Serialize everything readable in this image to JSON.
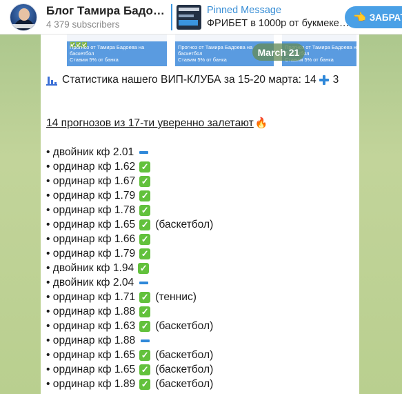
{
  "header": {
    "channel_title": "Блог Тамира Бадо…",
    "subscribers": "4 379 subscribers",
    "pinned_title": "Pinned Message",
    "pinned_text": "ФРИБЕТ в 1000р от букмеке…",
    "subscribe_label": "ЗАБРАТ"
  },
  "photos": [
    {
      "line1": "Прогноз от Тамира Бадоева на",
      "line2": "баскетбол",
      "line3": "Ставим 5% от банка"
    },
    {
      "line1": "Прогноз от Тамира Бадоева на",
      "line2": "баскетбол",
      "line3": "Ставим 5% от банка"
    },
    {
      "line1": "Прогноз от Тамира Бадоева на",
      "line2": "баскетбол",
      "line3": "Ставим 5% от банка"
    }
  ],
  "date_badge": "March 21",
  "message": {
    "headline_text": "Статистика нашего ВИП-КЛУБА за 15-20 марта: 14",
    "headline_tail": "3",
    "summary": "14 прогнозов из 17-ти уверенно залетают",
    "rows": [
      {
        "text": "• двойник кф 2.01",
        "mark": "minus",
        "note": ""
      },
      {
        "text": "• ординар кф 1.62",
        "mark": "check",
        "note": ""
      },
      {
        "text": "• ординар кф 1.67",
        "mark": "check",
        "note": ""
      },
      {
        "text": "• ординар кф 1.79",
        "mark": "check",
        "note": ""
      },
      {
        "text": "• ординар кф 1.78",
        "mark": "check",
        "note": ""
      },
      {
        "text": "• ординар кф 1.65",
        "mark": "check",
        "note": "(баскетбол)"
      },
      {
        "text": "• ординар кф 1.66",
        "mark": "check",
        "note": ""
      },
      {
        "text": "• ординар кф 1.79",
        "mark": "check",
        "note": ""
      },
      {
        "text": "• двойник кф 1.94",
        "mark": "check",
        "note": ""
      },
      {
        "text": "• двойник кф 2.04",
        "mark": "minus",
        "note": ""
      },
      {
        "text": "• ординар кф 1.71",
        "mark": "check",
        "note": "(теннис)"
      },
      {
        "text": "• ординар кф 1.88",
        "mark": "check",
        "note": ""
      },
      {
        "text": "• ординар кф 1.63",
        "mark": "check",
        "note": "(баскетбол)"
      },
      {
        "text": "• ординар кф 1.88",
        "mark": "minus",
        "note": ""
      },
      {
        "text": "• ординар кф 1.65",
        "mark": "check",
        "note": "(баскетбол)"
      },
      {
        "text": "• ординар кф 1.65",
        "mark": "check",
        "note": "(баскетбол)"
      },
      {
        "text": "• ординар кф 1.89",
        "mark": "check",
        "note": "(баскетбол)"
      }
    ]
  },
  "colors": {
    "accent": "#3a95e0",
    "check": "#62c13c",
    "minus": "#2f88d9",
    "background": "#b9cf8f"
  },
  "icons": {
    "chart": "bar-chart-icon",
    "plus": "plus-icon",
    "fire": "fire-icon",
    "check": "check-mark-icon",
    "minus": "minus-icon",
    "hand": "pointing-hand-icon"
  }
}
